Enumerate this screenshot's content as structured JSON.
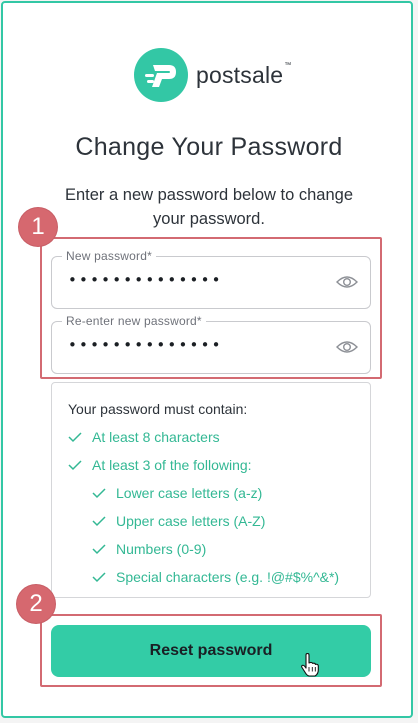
{
  "brand": {
    "name": "postsale",
    "tm": "™",
    "color": "#33c7a5"
  },
  "page": {
    "title": "Change Your Password",
    "subtitle": "Enter a new password below to change your password."
  },
  "form": {
    "new_password": {
      "label": "New password*",
      "value": "••••••••••••••"
    },
    "reenter_password": {
      "label": "Re-enter new password*",
      "value": "••••••••••••••"
    }
  },
  "requirements": {
    "heading": "Your password must contain:",
    "items": [
      "At least 8 characters",
      "At least 3 of the following:",
      "Lower case letters (a-z)",
      "Upper case letters (A-Z)",
      "Numbers (0-9)",
      "Special characters (e.g. !@#$%^&*)"
    ],
    "color": "#33b894"
  },
  "actions": {
    "reset_label": "Reset password",
    "color": "#33cca6"
  },
  "annotations": {
    "step1": "1",
    "step2": "2",
    "color": "#d6686f"
  }
}
